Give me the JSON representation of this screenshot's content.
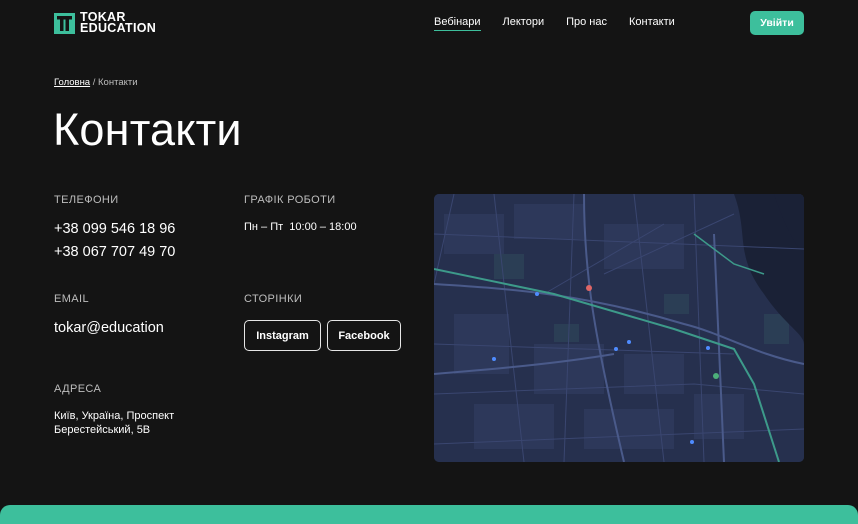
{
  "header": {
    "logo_line1": "TOKAR",
    "logo_line2": "EDUCATION",
    "nav": [
      {
        "label": "Вебінари",
        "active": true
      },
      {
        "label": "Лектори",
        "active": false
      },
      {
        "label": "Про нас",
        "active": false
      },
      {
        "label": "Контакти",
        "active": false
      }
    ],
    "login_label": "Увійти"
  },
  "breadcrumb": {
    "home": "Головна",
    "separator": "/",
    "current": "Контакти"
  },
  "page_title": "Контакти",
  "phones": {
    "label": "ТЕЛЕФОНИ",
    "items": [
      "+38 099 546 18 96",
      "+38 067 707 49 70"
    ]
  },
  "schedule": {
    "label": "ГРАФІК РОБОТИ",
    "days": "Пн – Пт",
    "hours": "10:00 – 18:00"
  },
  "email": {
    "label": "EMAIL",
    "value": "tokar@education"
  },
  "pages": {
    "label": "СТОРІНКИ",
    "instagram": "Instagram",
    "facebook": "Facebook"
  },
  "address": {
    "label": "АДРЕСА",
    "line1": "Київ, Україна, Проспект",
    "line2": "Берестейський, 5В"
  },
  "colors": {
    "accent": "#3dbf9c",
    "background": "#141414",
    "map_bg": "#26304e"
  }
}
